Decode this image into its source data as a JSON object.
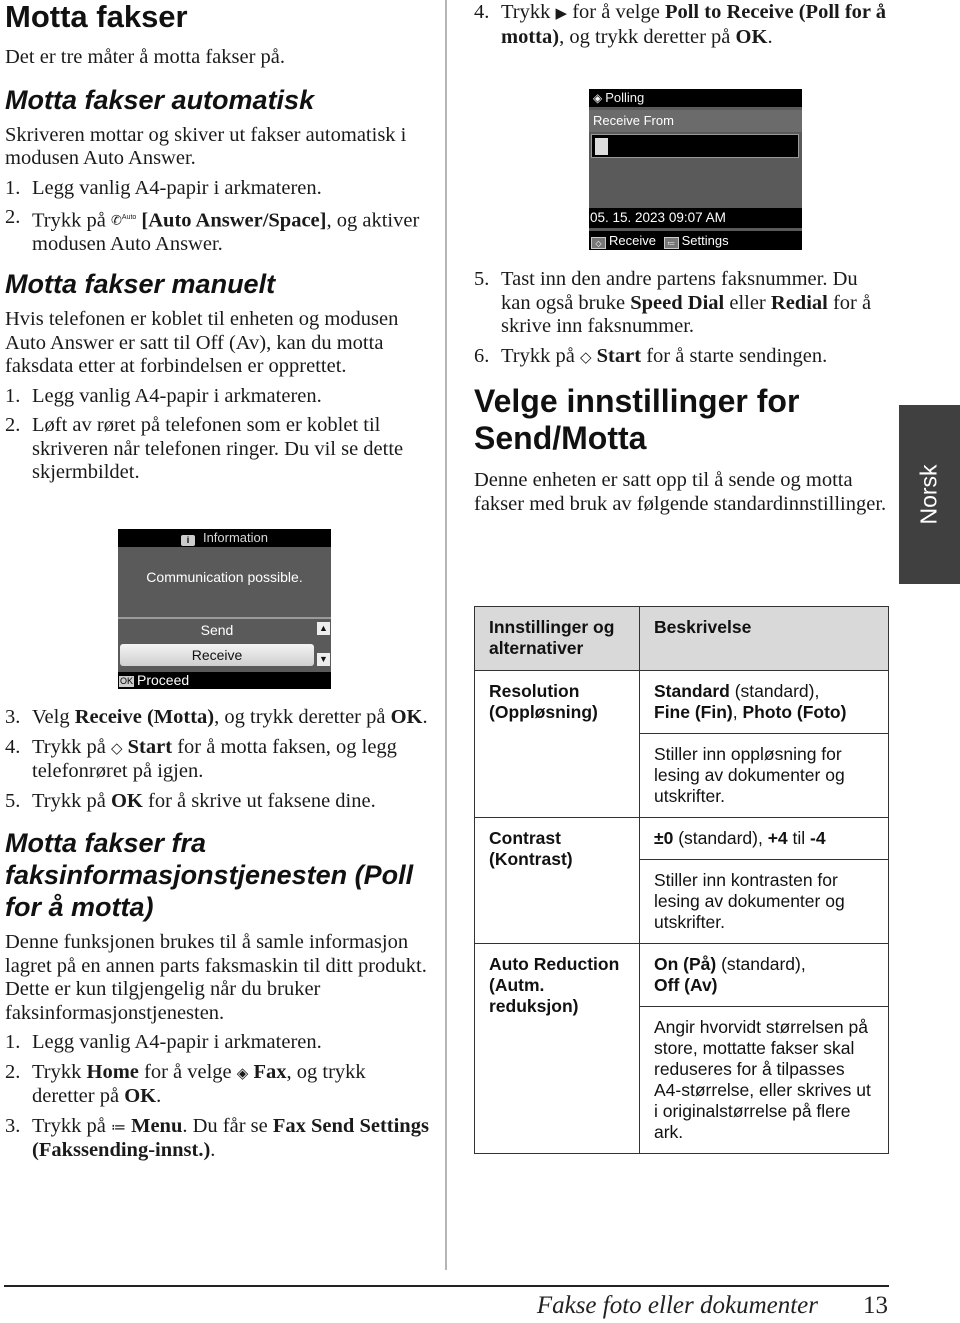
{
  "left": {
    "title": "Motta fakser",
    "intro": "Det er tre måter å motta fakser på.",
    "auto": {
      "heading": "Motta fakser automatisk",
      "body": "Skriveren mottar og skiver ut fakser automatisk i modusen Auto Answer.",
      "steps": [
        {
          "num": "1.",
          "text": "Legg vanlig A4-papir i arkmateren."
        },
        {
          "num": "2.",
          "pre": "Trykk på",
          "icon_label": "Auto",
          "bold": "[Auto Answer/Space]",
          "post": ", og aktiver modusen Auto Answer."
        }
      ]
    },
    "manual": {
      "heading": "Motta fakser manuelt",
      "body": "Hvis telefonen er koblet til enheten og modusen Auto Answer er satt til Off (Av), kan du motta faksdata etter at forbindelsen er opprettet.",
      "steps": [
        {
          "num": "1.",
          "text": "Legg vanlig A4-papir i arkmateren."
        },
        {
          "num": "2.",
          "text": "Løft av røret på telefonen som er koblet til skriveren når telefonen ringer. Du vil se dette skjermbildet."
        },
        {
          "num": "3.",
          "pre": "Velg ",
          "bold": "Receive (Motta)",
          "mid": ", og trykk deretter på ",
          "bold2": "OK",
          "post": "."
        },
        {
          "num": "4.",
          "pre": "Trykk på ",
          "icon": "◇",
          "bold": "Start",
          "post": " for å motta faksen, og legg telefonrøret på igjen."
        },
        {
          "num": "5.",
          "pre": "Trykk på ",
          "bold": "OK",
          "post": " for å skrive ut faksene dine."
        }
      ]
    },
    "lcd_info": {
      "title": "Information",
      "message": "Communication possible.",
      "options": [
        "Send",
        "Receive"
      ],
      "selected": "Receive",
      "ok_key": "OK",
      "footer": "Proceed"
    },
    "poll": {
      "heading": "Motta fakser fra faksinformasjonstjenesten (Poll for å motta)",
      "body": "Denne funksjonen brukes til å samle informasjon lagret på en annen parts faksmaskin til ditt produkt. Dette er kun tilgjengelig når du bruker faksinformasjonstjenesten.",
      "steps": [
        {
          "num": "1.",
          "text": "Legg vanlig A4-papir i arkmateren."
        },
        {
          "num": "2.",
          "pre": "Trykk ",
          "bold": "Home",
          "mid": " for å velge ",
          "icon": "◈",
          "bold2": "Fax",
          "post": ", og trykk deretter på ",
          "bold3": "OK",
          "end": "."
        },
        {
          "num": "3.",
          "pre": "Trykk på ",
          "icon": "≔",
          "bold": "Menu",
          "mid": ". Du får se ",
          "bold2": "Fax Send Settings (Fakssending-innst.)",
          "post": "."
        }
      ]
    }
  },
  "right": {
    "steps_top": [
      {
        "num": "4.",
        "pre": "Trykk ",
        "icon": "▶",
        "mid": " for å velge ",
        "bold": "Poll to Receive (Poll for å motta)",
        "post": ", og trykk deretter på ",
        "bold2": "OK",
        "end": "."
      }
    ],
    "lcd_poll": {
      "title": "Polling",
      "subtitle": "Receive From",
      "input_value": "",
      "datetime": "05. 15. 2023  09:07 AM",
      "footer_receive": "Receive",
      "footer_settings": "Settings"
    },
    "steps_bottom": [
      {
        "num": "5.",
        "pre": "Tast inn den andre partens faksnummer. Du kan også bruke ",
        "bold": "Speed Dial",
        "mid": " eller ",
        "bold2": "Redial",
        "post": " for å skrive inn faksnummer."
      },
      {
        "num": "6.",
        "pre": "Trykk på ",
        "icon": "◇",
        "bold": "Start",
        "post": " for å starte sendingen."
      }
    ],
    "settings": {
      "heading": "Velge innstillinger for Send/Motta",
      "body": "Denne enheten er satt opp til å sende og motta fakser med bruk av følgende standardinnstillinger."
    },
    "table": {
      "headers": [
        "Innstillinger og alternativer",
        "Beskrivelse"
      ],
      "rows": [
        {
          "setting": "Resolution (Oppløsning)",
          "options_bold1": "Standard",
          "options_text1": " (standard),",
          "options_bold2": "Fine (Fin)",
          "options_text2": ", ",
          "options_bold3": "Photo (Foto)",
          "description": "Stiller inn oppløsning for lesing av dokumenter og utskrifter."
        },
        {
          "setting": "Contrast (Kontrast)",
          "options_bold1": "±0",
          "options_text1": " (standard), ",
          "options_bold2": "+4",
          "options_text2": " til ",
          "options_bold3": "-4",
          "description": "Stiller inn kontrasten for lesing av dokumenter og utskrifter."
        },
        {
          "setting": "Auto Reduction (Autm. reduksjon)",
          "options_bold1": "On (På)",
          "options_text1": " (standard),",
          "options_bold2": "Off (Av)",
          "options_text2": "",
          "options_bold3": "",
          "description": "Angir hvorvidt størrelsen på store, mottatte fakser skal reduseres for å tilpasses A4-størrelse, eller skrives ut i originalstørrelse på flere ark."
        }
      ]
    }
  },
  "side_tab": "Norsk",
  "footer": {
    "title": "Fakse foto eller dokumenter",
    "page": "13"
  }
}
